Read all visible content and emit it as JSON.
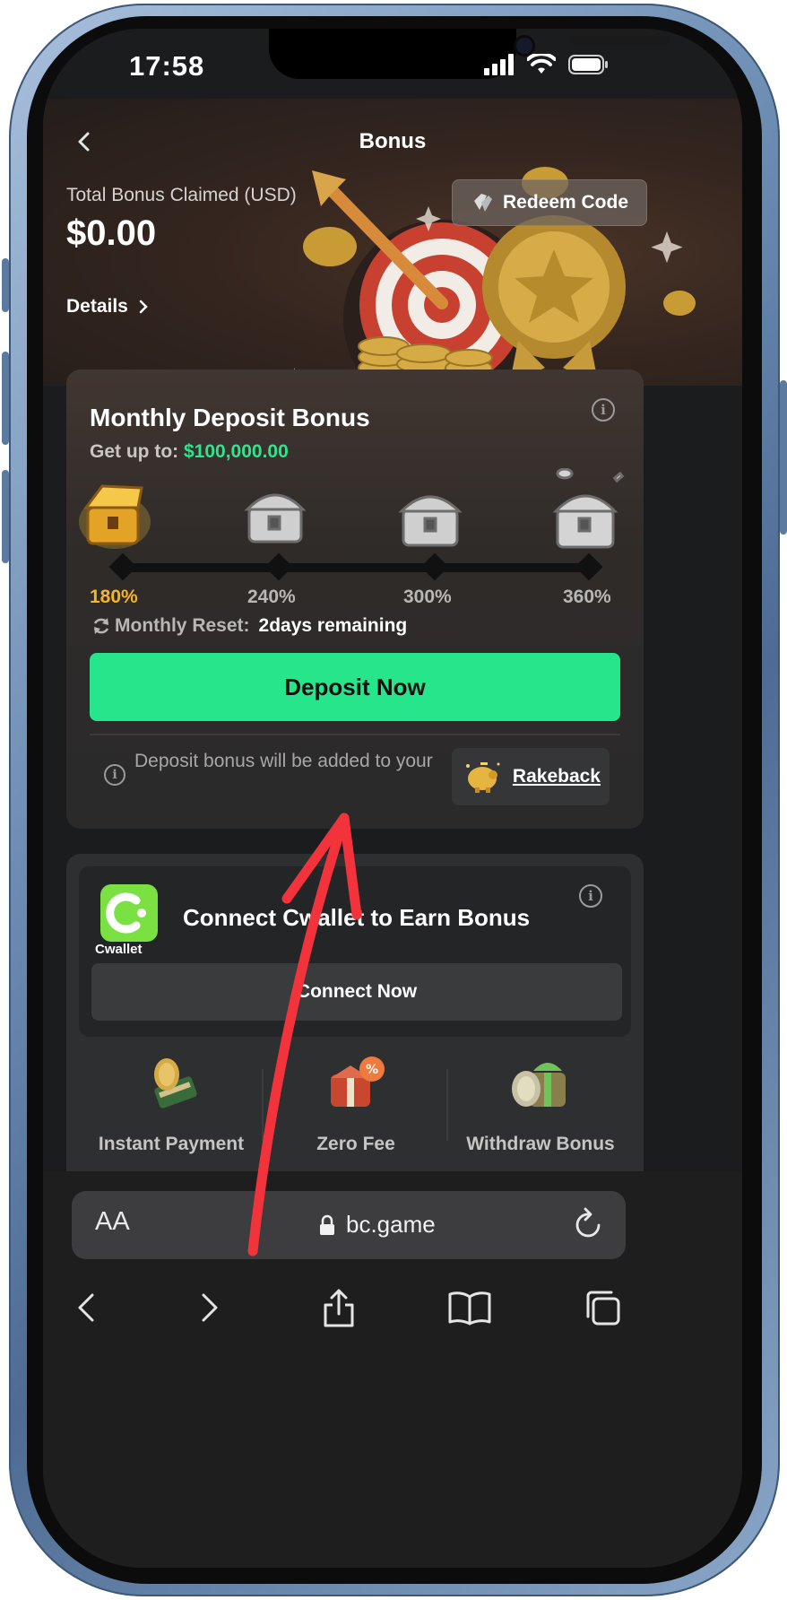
{
  "status_bar": {
    "time": "17:58"
  },
  "header": {
    "title": "Bonus",
    "back_icon": "chevron-left-icon"
  },
  "summary": {
    "total_label": "Total Bonus Claimed (USD)",
    "total_value": "$0.00",
    "details_label": "Details",
    "redeem_label": "Redeem Code"
  },
  "deposit_bonus": {
    "title": "Monthly Deposit Bonus",
    "get_up_label": "Get up to:",
    "get_up_amount": "$100,000.00",
    "tiers": [
      "180%",
      "240%",
      "300%",
      "360%"
    ],
    "active_tier_index": 0,
    "reset_label": "Monthly Reset:",
    "reset_remaining": "2days remaining",
    "deposit_button": "Deposit Now",
    "note": "Deposit bonus will be added to your",
    "rakeback_label": "Rakeback"
  },
  "cwallet": {
    "logo_text": "Cwallet",
    "title": "Connect Cwallet to Earn Bonus",
    "connect_button": "Connect Now",
    "features": [
      "Instant Payment",
      "Zero Fee",
      "Withdraw Bonus"
    ]
  },
  "browser": {
    "aa_label": "AA",
    "url": "bc.game"
  },
  "colors": {
    "accent_green": "#27e58a",
    "amount_green": "#2fe58c",
    "active_tier": "#f5b52a",
    "annotation_arrow": "#f2333b"
  }
}
